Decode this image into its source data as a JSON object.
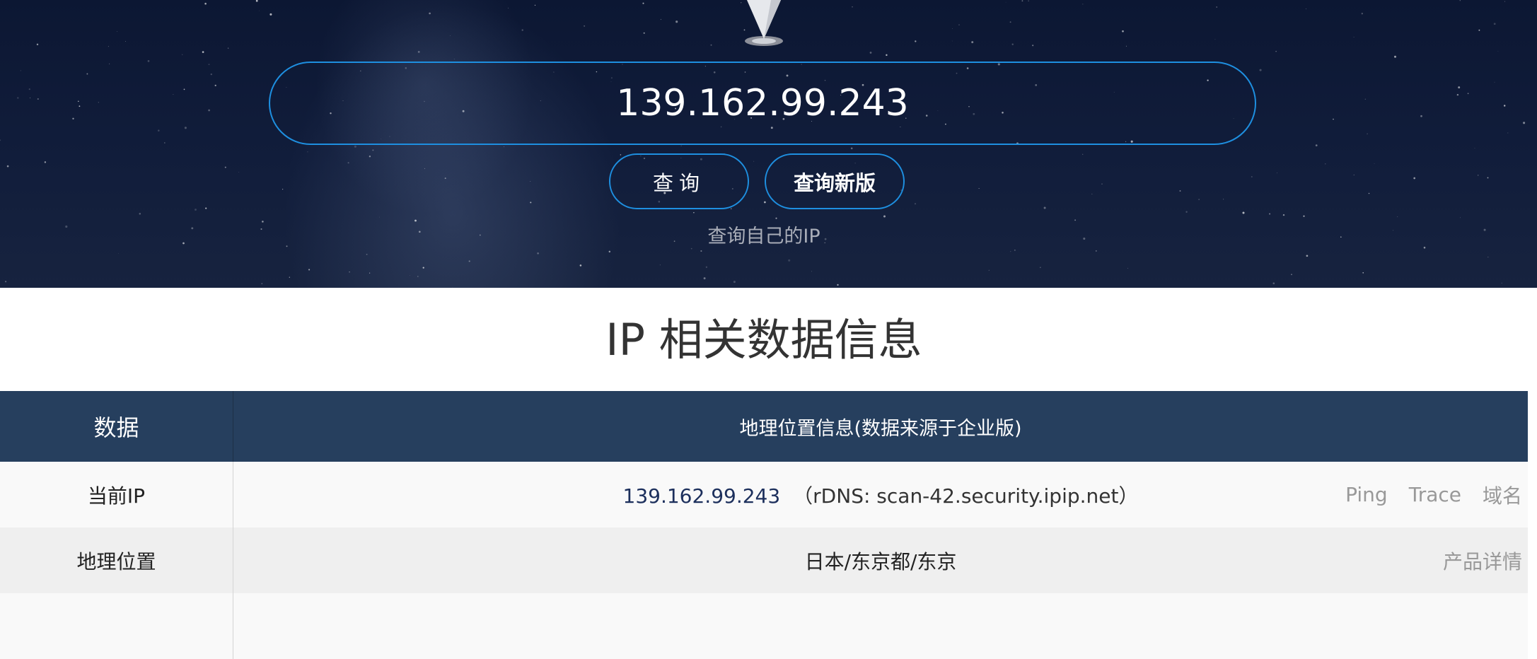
{
  "search": {
    "ip_value": "139.162.99.243",
    "query_label": "查询",
    "query_new_label": "查询新版",
    "self_ip_label": "查询自己的IP"
  },
  "section": {
    "title": "IP 相关数据信息"
  },
  "table": {
    "headers": [
      "数据",
      "地理位置信息(数据来源于企业版)"
    ],
    "rows": [
      {
        "key": "当前IP",
        "ip": "139.162.99.243",
        "rdns": "（rDNS: scan-42.security.ipip.net）",
        "actions": [
          "Ping",
          "Trace",
          "域名"
        ]
      },
      {
        "key": "地理位置",
        "value": "日本/东京都/东京",
        "actions": [
          "产品详情"
        ]
      }
    ]
  },
  "colors": {
    "hero_bg": "#0c1733",
    "accent_border": "#1e8fe0",
    "table_header_bg": "#263f5e",
    "ip_text": "#1c2f5c",
    "muted_text": "#999999"
  },
  "icons": {
    "location_pin": "map-pin-icon"
  }
}
